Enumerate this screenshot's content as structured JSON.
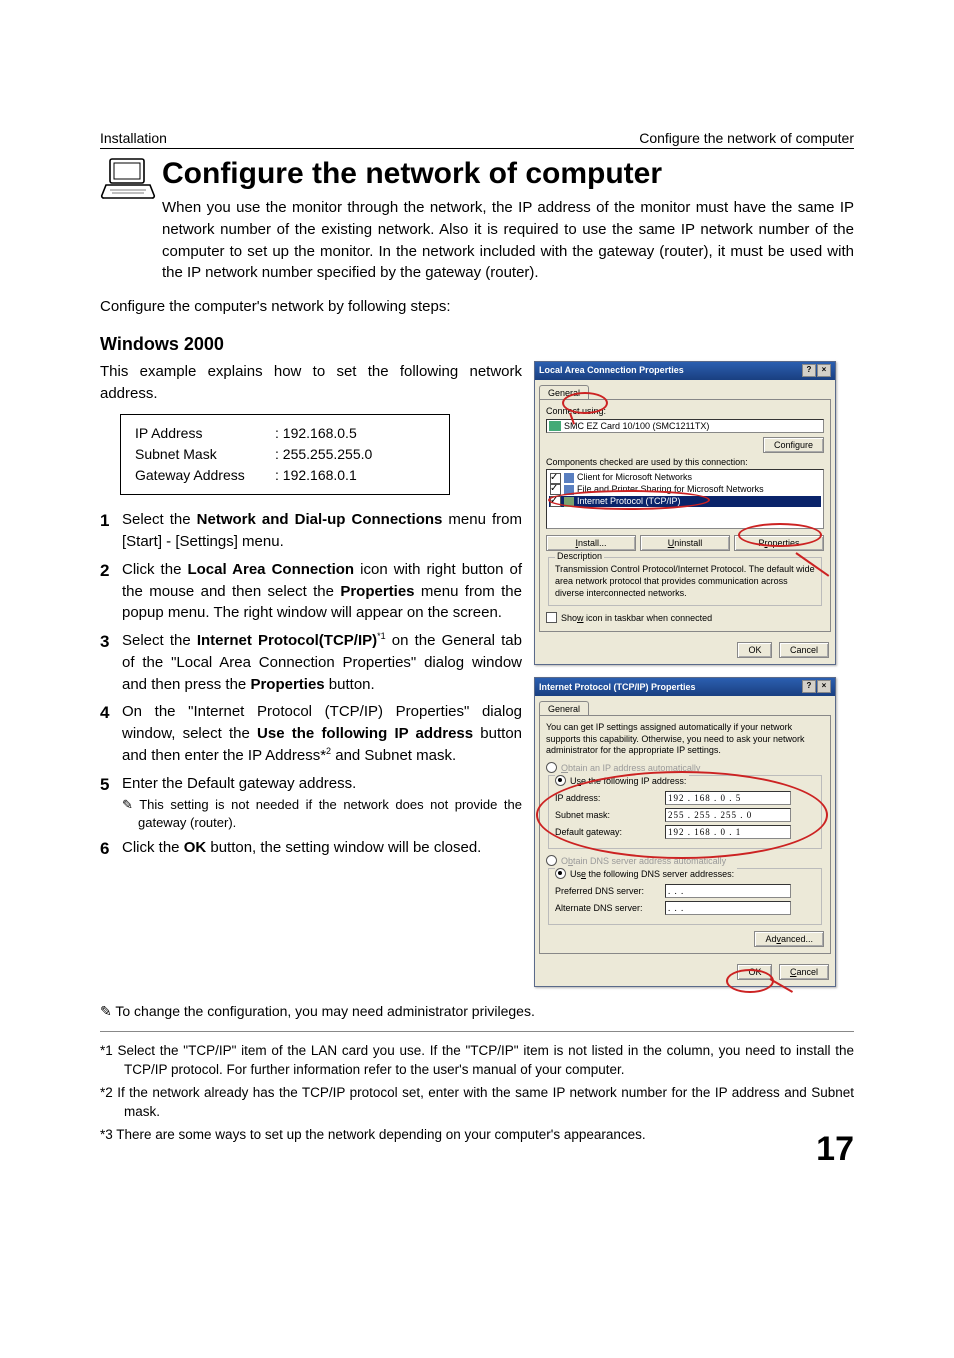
{
  "header": {
    "left": "Installation",
    "right": "Configure the network of computer"
  },
  "title": "Configure the network of computer",
  "intro1": "When you use the monitor through the network, the IP address of the monitor must have the same IP network number of the existing network. Also it is required to use the same IP network number of the computer to set up the monitor. In the network included with the gateway (router), it must be used with the IP network number specified by the gateway (router).",
  "intro2": "Configure the computer's network by following steps:",
  "section": "Windows 2000",
  "example_lead": "This example explains how to set the following network address.",
  "addr": {
    "ip_label": "IP Address",
    "ip": ": 192.168.0.5",
    "mask_label": "Subnet Mask",
    "mask": ": 255.255.255.0",
    "gw_label": "Gateway Address",
    "gw": ": 192.168.0.1"
  },
  "steps": {
    "s1a": "Select the ",
    "s1b": "Network and Dial-up Connections",
    "s1c": " menu from [Start] - [Settings] menu.",
    "s2a": "Click the ",
    "s2b": "Local Area Connection",
    "s2c": " icon with right button of the mouse and then select the ",
    "s2d": "Properties",
    "s2e": " menu from the popup menu. The right window will appear on the screen.",
    "s3a": "Select the ",
    "s3b": "Internet Protocol(TCP/IP)",
    "s3sup": "*1",
    "s3c": " on the General tab of the \"Local Area Connection Properties\" dialog window and then press the ",
    "s3d": "Properties",
    "s3e": " button.",
    "s4a": "On the \"Internet Protocol (TCP/IP) Properties\" dialog window, select the ",
    "s4b": "Use the following IP address",
    "s4c": " button and then enter the IP Address*",
    "s4sup": "2",
    "s4d": " and Subnet mask.",
    "s5": "Enter the Default gateway address.",
    "s5note": "This setting is not needed if the network does not provide the gateway (router).",
    "s6a": "Click the ",
    "s6b": "OK",
    "s6c": " button, the setting window will be closed."
  },
  "note_admin": "To change the configuration, you may need administrator privileges.",
  "fn1": "*1 Select the \"TCP/IP\" item of the LAN card you use. If the \"TCP/IP\" item is not listed in the column, you need to install the TCP/IP protocol. For further information refer to the user's manual of your computer.",
  "fn2": "*2 If the network already has the TCP/IP protocol set, enter with the same IP network number for the IP address and Subnet mask.",
  "fn3": "*3 There are some ways to set up the network depending on your computer's appearances.",
  "page_num": "17",
  "dlg1": {
    "title": "Local Area Connection Properties",
    "tab": "General",
    "connect_using": "Connect using:",
    "nic": "SMC EZ Card 10/100 (SMC1211TX)",
    "configure": "Configure",
    "components_label": "Components checked are used by this connection:",
    "items": [
      "Client for Microsoft Networks",
      "File and Printer Sharing for Microsoft Networks",
      "Internet Protocol (TCP/IP)"
    ],
    "install": "Install...",
    "uninstall": "Uninstall",
    "properties": "Properties",
    "desc_label": "Description",
    "desc_text": "Transmission Control Protocol/Internet Protocol. The default wide area network protocol that provides communication across diverse interconnected networks.",
    "show_icon": "Show icon in taskbar when connected",
    "ok": "OK",
    "cancel": "Cancel"
  },
  "dlg2": {
    "title": "Internet Protocol (TCP/IP) Properties",
    "tab": "General",
    "blurb": "You can get IP settings assigned automatically if your network supports this capability. Otherwise, you need to ask your network administrator for the appropriate IP settings.",
    "r1": "Obtain an IP address automatically",
    "r2": "Use the following IP address:",
    "ip_label": "IP address:",
    "ip_val": "192 . 168 .   0  .   5",
    "mask_label": "Subnet mask:",
    "mask_val": "255 . 255 . 255 .   0",
    "gw_label": "Default gateway:",
    "gw_val": "192 . 168 .   0  .   1",
    "r3": "Obtain DNS server address automatically",
    "r4": "Use the following DNS server addresses:",
    "pref_dns": "Preferred DNS server:",
    "alt_dns": "Alternate DNS server:",
    "dot_val": " .      .      . ",
    "advanced": "Advanced...",
    "ok": "OK",
    "cancel": "Cancel"
  }
}
